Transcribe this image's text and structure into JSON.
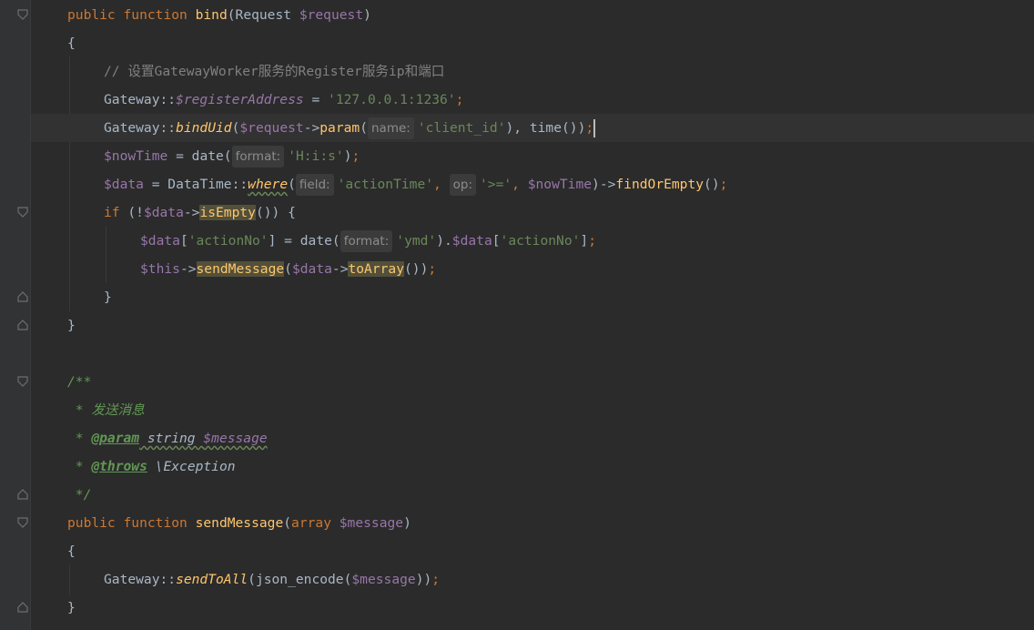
{
  "editor": {
    "lines": [
      {
        "k": "l1",
        "segs": [
          [
            "kw",
            "public "
          ],
          [
            "kw",
            "function "
          ],
          [
            "fn",
            "bind"
          ],
          [
            "pl",
            "(Request "
          ],
          [
            "var",
            "$request"
          ],
          [
            "pl",
            ")"
          ]
        ]
      },
      {
        "k": "l2",
        "segs": [
          [
            "pl",
            "{"
          ]
        ]
      },
      {
        "k": "l3",
        "segs": [
          [
            "cm",
            "// 设置GatewayWorker服务的Register服务ip和端口"
          ]
        ]
      },
      {
        "k": "l4",
        "segs": [
          [
            "pl",
            "Gateway::"
          ],
          [
            "sfield",
            "$registerAddress"
          ],
          [
            "pl",
            " = "
          ],
          [
            "str",
            "'127.0.0.1:1236'"
          ],
          [
            "kw",
            ";"
          ]
        ]
      },
      {
        "k": "l5",
        "segs": [
          [
            "pl",
            "Gateway::"
          ],
          [
            "sfn",
            "bindUid"
          ],
          [
            "pl",
            "("
          ],
          [
            "var",
            "$request"
          ],
          [
            "pl",
            "->"
          ],
          [
            "fn",
            "param"
          ],
          [
            "pl",
            "("
          ],
          [
            "hint",
            "name:"
          ],
          [
            "str",
            "'client_id'"
          ],
          [
            "pl",
            "), "
          ],
          [
            "pl",
            "time"
          ],
          [
            "pl",
            "())"
          ],
          [
            "kw",
            ";"
          ],
          [
            "caret",
            ""
          ]
        ]
      },
      {
        "k": "l6",
        "segs": [
          [
            "var",
            "$nowTime"
          ],
          [
            "pl",
            " = date("
          ],
          [
            "hint",
            "format:"
          ],
          [
            "str",
            "'H:i:s'"
          ],
          [
            "pl",
            ")"
          ],
          [
            "kw",
            ";"
          ]
        ]
      },
      {
        "k": "l7",
        "segs": [
          [
            "var",
            "$data"
          ],
          [
            "pl",
            " = DataTime::"
          ],
          [
            "sfnw",
            "where"
          ],
          [
            "pl",
            "("
          ],
          [
            "hint",
            "field:"
          ],
          [
            "str",
            "'actionTime'"
          ],
          [
            "kw",
            ", "
          ],
          [
            "hint",
            "op:"
          ],
          [
            "str",
            "'>='"
          ],
          [
            "kw",
            ", "
          ],
          [
            "var",
            "$nowTime"
          ],
          [
            "pl",
            ")->"
          ],
          [
            "fn",
            "findOrEmpty"
          ],
          [
            "pl",
            "()"
          ],
          [
            "kw",
            ";"
          ]
        ]
      },
      {
        "k": "l8",
        "segs": [
          [
            "kw",
            "if "
          ],
          [
            "pl",
            "(!"
          ],
          [
            "var",
            "$data"
          ],
          [
            "pl",
            "->"
          ],
          [
            "fnhl",
            "isEmpty"
          ],
          [
            "pl",
            "()) {"
          ]
        ]
      },
      {
        "k": "l9",
        "segs": [
          [
            "var",
            "$data"
          ],
          [
            "pl",
            "["
          ],
          [
            "str",
            "'actionNo'"
          ],
          [
            "pl",
            "] = date("
          ],
          [
            "hint",
            "format:"
          ],
          [
            "str",
            "'ymd'"
          ],
          [
            "pl",
            ")."
          ],
          [
            "var",
            "$data"
          ],
          [
            "pl",
            "["
          ],
          [
            "str",
            "'actionNo'"
          ],
          [
            "pl",
            "]"
          ],
          [
            "kw",
            ";"
          ]
        ]
      },
      {
        "k": "l10",
        "segs": [
          [
            "var",
            "$this"
          ],
          [
            "pl",
            "->"
          ],
          [
            "fnhl",
            "sendMessage"
          ],
          [
            "pl",
            "("
          ],
          [
            "var",
            "$data"
          ],
          [
            "pl",
            "->"
          ],
          [
            "fnhl",
            "toArray"
          ],
          [
            "pl",
            "())"
          ],
          [
            "kw",
            ";"
          ]
        ]
      },
      {
        "k": "l11",
        "segs": [
          [
            "pl",
            "}"
          ]
        ]
      },
      {
        "k": "l12",
        "segs": [
          [
            "pl",
            "}"
          ]
        ]
      },
      {
        "k": "l13",
        "segs": []
      },
      {
        "k": "l14",
        "segs": [
          [
            "doc",
            "/**"
          ]
        ]
      },
      {
        "k": "l15",
        "segs": [
          [
            "doc",
            " * 发送消息"
          ]
        ]
      },
      {
        "k": "l16",
        "segs": [
          [
            "doc",
            " * "
          ],
          [
            "doctag",
            "@param"
          ],
          [
            "doctypew",
            " string "
          ],
          [
            "sfieldw",
            "$message"
          ]
        ]
      },
      {
        "k": "l17",
        "segs": [
          [
            "doc",
            " * "
          ],
          [
            "doctag",
            "@throws"
          ],
          [
            "doc",
            " "
          ],
          [
            "doctype",
            "\\Exception"
          ]
        ]
      },
      {
        "k": "l18",
        "segs": [
          [
            "doc",
            " */"
          ]
        ]
      },
      {
        "k": "l19",
        "segs": [
          [
            "kw",
            "public "
          ],
          [
            "kw",
            "function "
          ],
          [
            "fn",
            "sendMessage"
          ],
          [
            "pl",
            "("
          ],
          [
            "kw",
            "array "
          ],
          [
            "var",
            "$message"
          ],
          [
            "pl",
            ")"
          ]
        ]
      },
      {
        "k": "l20",
        "segs": [
          [
            "pl",
            "{"
          ]
        ]
      },
      {
        "k": "l21",
        "segs": [
          [
            "pl",
            "Gateway::"
          ],
          [
            "sfn",
            "sendToAll"
          ],
          [
            "pl",
            "(json_encode("
          ],
          [
            "var",
            "$message"
          ],
          [
            "pl",
            "))"
          ],
          [
            "kw",
            ";"
          ]
        ]
      },
      {
        "k": "l22",
        "segs": [
          [
            "pl",
            "}"
          ]
        ]
      }
    ]
  }
}
